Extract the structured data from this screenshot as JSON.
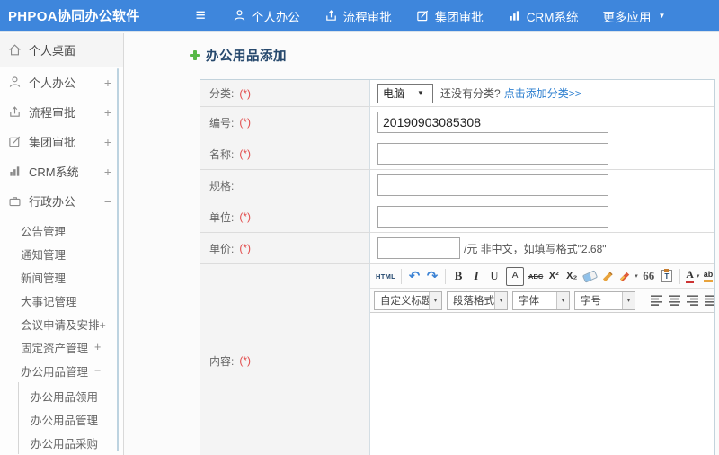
{
  "topbar": {
    "logo": "PHPOA协同办公软件",
    "menu_icon": "≡",
    "nav": [
      {
        "label": "个人办公",
        "icon": "user-icon"
      },
      {
        "label": "流程审批",
        "icon": "flow-icon"
      },
      {
        "label": "集团审批",
        "icon": "edit-icon"
      },
      {
        "label": "CRM系统",
        "icon": "chart-icon"
      },
      {
        "label": "更多应用",
        "icon": "caret-down-icon",
        "caret": "▼"
      }
    ]
  },
  "sidebar": {
    "items": [
      {
        "label": "个人桌面",
        "icon": "home-icon",
        "expander": ""
      },
      {
        "label": "个人办公",
        "icon": "user-icon",
        "expander": "+"
      },
      {
        "label": "流程审批",
        "icon": "flow-icon",
        "expander": "+"
      },
      {
        "label": "集团审批",
        "icon": "edit-icon",
        "expander": "+"
      },
      {
        "label": "CRM系统",
        "icon": "chart-icon",
        "expander": "+"
      },
      {
        "label": "行政办公",
        "icon": "briefcase-icon",
        "expander": "−"
      }
    ],
    "admin_submenu": [
      {
        "label": "公告管理",
        "expander": ""
      },
      {
        "label": "通知管理",
        "expander": ""
      },
      {
        "label": "新闻管理",
        "expander": ""
      },
      {
        "label": "大事记管理",
        "expander": ""
      },
      {
        "label": "会议申请及安排+",
        "expander": ""
      },
      {
        "label": "固定资产管理",
        "expander": "+"
      },
      {
        "label": "办公用品管理",
        "expander": "−"
      }
    ],
    "supplies_submenu": [
      {
        "label": "办公用品领用"
      },
      {
        "label": "办公用品管理"
      },
      {
        "label": "办公用品采购"
      }
    ]
  },
  "main": {
    "title": "办公用品添加",
    "form": {
      "category": {
        "label": "分类:",
        "required": "(*)",
        "select_value": "电脑",
        "select_caret": "▼",
        "hint": "还没有分类?",
        "link": "点击添加分类>>"
      },
      "code": {
        "label": "编号:",
        "required": "(*)",
        "value": "20190903085308"
      },
      "name": {
        "label": "名称:",
        "required": "(*)",
        "value": ""
      },
      "spec": {
        "label": "规格:",
        "required": "",
        "value": ""
      },
      "unit": {
        "label": "单位:",
        "required": "(*)",
        "value": ""
      },
      "price": {
        "label": "单价:",
        "required": "(*)",
        "value": "",
        "suffix": "/元 非中文，如填写格式\"2.68\""
      },
      "content": {
        "label": "内容:",
        "required": "(*)"
      }
    },
    "editor": {
      "caret": "▾",
      "toolbar1": {
        "html": "HTML",
        "undo": "↶",
        "redo": "↷",
        "bold": "B",
        "italic": "I",
        "underline": "U",
        "boxed_a": "A",
        "strike": "ABC",
        "sup": "X²",
        "sub": "X₂",
        "quote": "66",
        "paste_t": "T",
        "font_color": "A",
        "highlight": "ab"
      },
      "dropdowns": [
        {
          "label": "自定义标题"
        },
        {
          "label": "段落格式"
        },
        {
          "label": "字体"
        },
        {
          "label": "字号"
        }
      ]
    }
  },
  "colors": {
    "topbar_blue": "#3e86dc",
    "link_blue": "#2f80d0",
    "required_red": "#e24b4b",
    "title_navy": "#27496d",
    "plus_green": "#57b847"
  }
}
